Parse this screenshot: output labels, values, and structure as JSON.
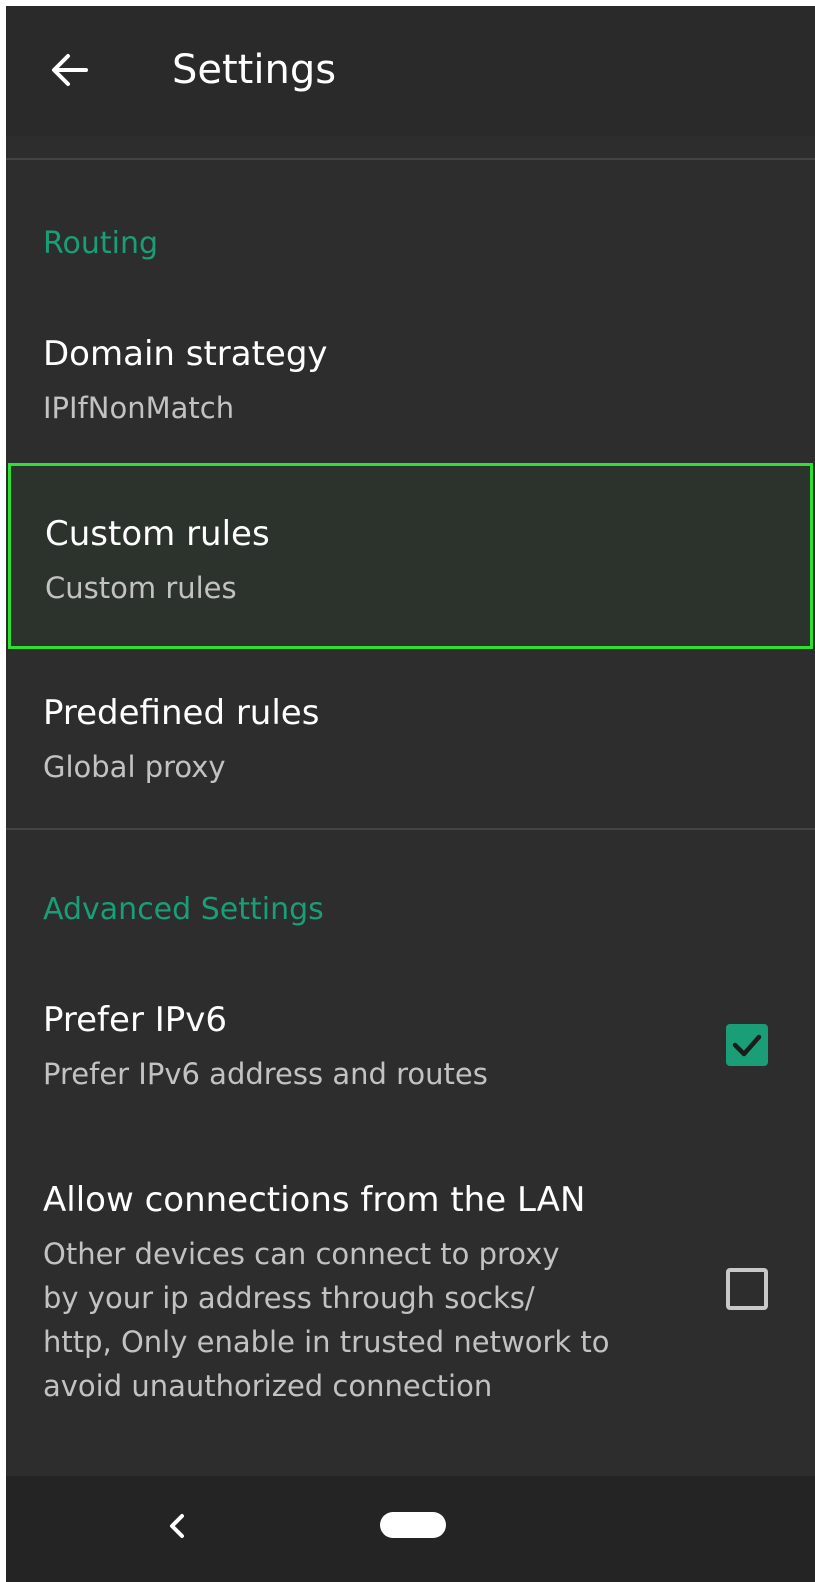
{
  "appbar": {
    "title": "Settings",
    "back_icon": "arrow-left-icon"
  },
  "sections": {
    "routing": {
      "header": "Routing",
      "domain_strategy": {
        "title": "Domain strategy",
        "summary": "IPIfNonMatch"
      },
      "custom_rules": {
        "title": "Custom rules",
        "summary": "Custom rules"
      },
      "predefined_rules": {
        "title": "Predefined rules",
        "summary": "Global proxy"
      }
    },
    "advanced": {
      "header": "Advanced Settings",
      "prefer_ipv6": {
        "title": "Prefer IPv6",
        "summary": "Prefer IPv6 address and routes",
        "checked": true
      },
      "allow_lan": {
        "title": "Allow connections from the LAN",
        "summary_lines": [
          "Other devices can connect to proxy",
          "by your ip address through socks/",
          "http, Only enable in trusted network to",
          "avoid unauthorized connection"
        ],
        "checked": false
      }
    }
  },
  "navbar": {
    "back_icon": "chevron-left-icon",
    "home_icon": "home-pill-icon"
  },
  "colors": {
    "accent": "#1a9e77",
    "background": "#2d2d2d",
    "highlight_border": "#2fe02f"
  }
}
